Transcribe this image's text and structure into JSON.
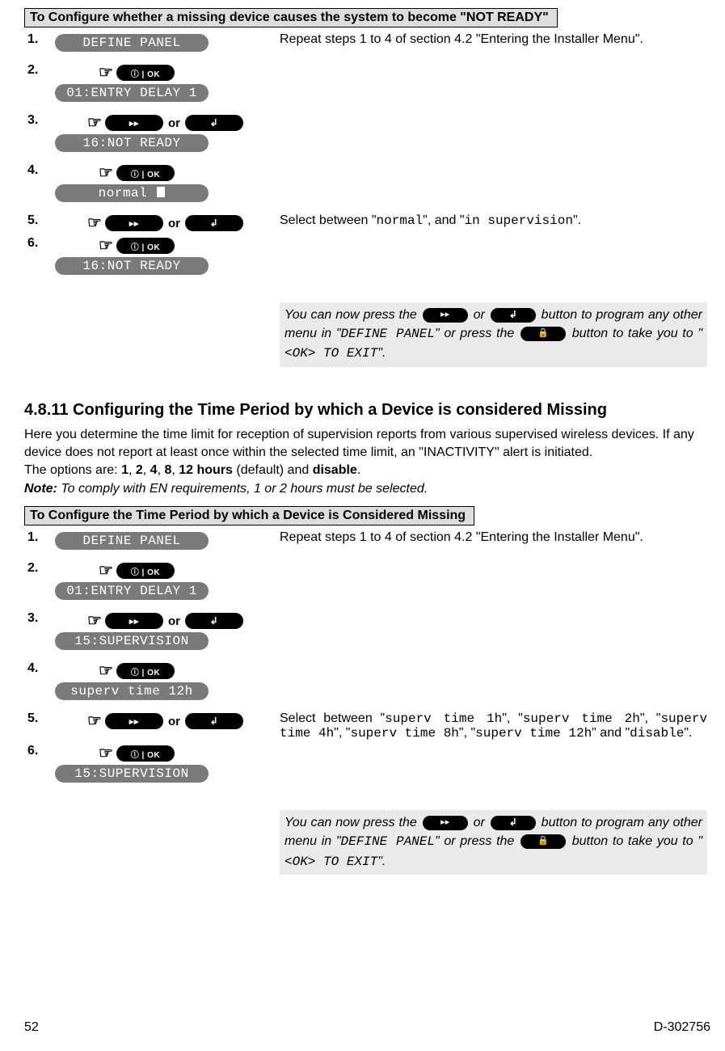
{
  "section1": {
    "title": "To Configure whether a missing device causes the system to become \"NOT READY\"",
    "steps": [
      {
        "n": "1.",
        "lcd": "DEFINE PANEL",
        "right": "Repeat steps 1 to 4 of section 4.2 \"Entering the Installer Menu\".",
        "or": false,
        "ok": false
      },
      {
        "n": "2.",
        "lcd": "01:ENTRY DELAY 1",
        "or": false,
        "ok": true
      },
      {
        "n": "3.",
        "lcd": "16:NOT READY",
        "or": true,
        "ok": false
      },
      {
        "n": "4.",
        "lcd": "normal ",
        "cursor": true,
        "or": false,
        "ok": true
      },
      {
        "n": "5.",
        "or": true,
        "ok": false,
        "right_html": true
      },
      {
        "n": "6.",
        "lcd": "16:NOT READY",
        "or": false,
        "ok": true
      }
    ],
    "step5_pre": "Select between \"",
    "step5_opt1": "normal",
    "step5_mid": "\", and \"",
    "step5_opt2": "in supervision",
    "step5_post": "\".",
    "note_p1": "You can now press the ",
    "note_or": " or ",
    "note_p2": " button to program any other menu in \"",
    "note_menu": "DEFINE PANEL",
    "note_p3": "\" or press the ",
    "note_p4": " button to take you to \"",
    "note_exit": "<OK> TO EXIT",
    "note_p5": "\"."
  },
  "subhead": "4.8.11 Configuring the Time Period by which a Device is considered Missing",
  "body1": "Here you determine the time limit for reception of supervision reports from various supervised wireless devices. If any device does not report at least once within the selected time limit, an \"INACTIVITY\" alert is initiated.",
  "body2_pre": "The options are: ",
  "body2_opts": [
    "1",
    "2",
    "4",
    "8",
    "12 hours"
  ],
  "body2_default": " (default) and ",
  "body2_disable": "disable",
  "body2_post": ".",
  "note_line_pre": "Note:",
  "note_line_mid": " To comply with EN requirements",
  "note_line_post": ", 1 or 2 hours must be selected.",
  "section2": {
    "title": "To Configure the Time Period by which a Device is Considered Missing",
    "steps": [
      {
        "n": "1.",
        "lcd": "DEFINE PANEL",
        "right": "Repeat steps 1 to 4 of section 4.2 \"Entering the Installer Menu\".",
        "or": false,
        "ok": false
      },
      {
        "n": "2.",
        "lcd": "01:ENTRY DELAY 1",
        "or": false,
        "ok": true
      },
      {
        "n": "3.",
        "lcd": "15:SUPERVISION",
        "or": true,
        "ok": false
      },
      {
        "n": "4.",
        "lcd": "superv time 12h",
        "or": false,
        "ok": true
      },
      {
        "n": "5.",
        "or": true,
        "ok": false,
        "right_html": true
      },
      {
        "n": "6.",
        "lcd": "15:SUPERVISION",
        "or": false,
        "ok": true
      }
    ],
    "step5_chunks": {
      "pre": "Select between \"",
      "o1": "superv time 1h",
      "s1": "\", \"",
      "o2": "superv time 2h",
      "s2": "\", \"",
      "o3": "superv time 4h",
      "s3": "\", \"",
      "o4": "superv time 8h",
      "s4": "\", \"",
      "o5": "superv time 12h",
      "s5": "\" and \"",
      "o6": "disable",
      "post": "\"."
    }
  },
  "footer": {
    "left": "52",
    "right": "D-302756"
  }
}
